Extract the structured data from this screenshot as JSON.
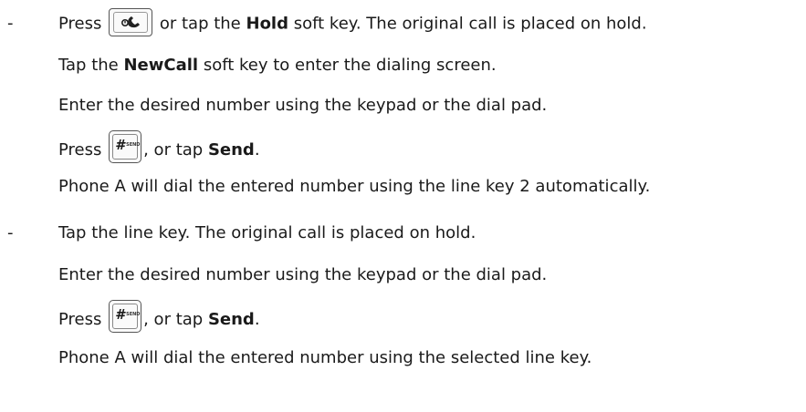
{
  "block1": {
    "dash": "-",
    "press_label": "Press",
    "hold_icon_name": "hold-key-icon",
    "or_tap_the": "or tap the",
    "hold_softkey": "Hold",
    "hold_suffix": "soft key. The original call is placed on hold.",
    "tap_the": "Tap the",
    "newcall_softkey": "NewCall",
    "newcall_suffix": "soft key to enter the dialing screen.",
    "enter_number": "Enter the desired number using the keypad or the dial pad.",
    "press_label_2": "Press",
    "send_key_hash": "#",
    "send_key_text": "SEND",
    "or_tap": ", or tap",
    "send_softkey": "Send",
    "period": ".",
    "result": "Phone A will dial the entered number using the line key 2 automatically."
  },
  "block2": {
    "dash": "-",
    "tap_line_key": "Tap the line key. The original call is placed on hold.",
    "enter_number": "Enter the desired number using the keypad or the dial pad.",
    "press_label": "Press",
    "send_key_hash": "#",
    "send_key_text": "SEND",
    "or_tap": ", or tap",
    "send_softkey": "Send",
    "period": ".",
    "result": "Phone A will dial the entered number using the selected line key."
  }
}
